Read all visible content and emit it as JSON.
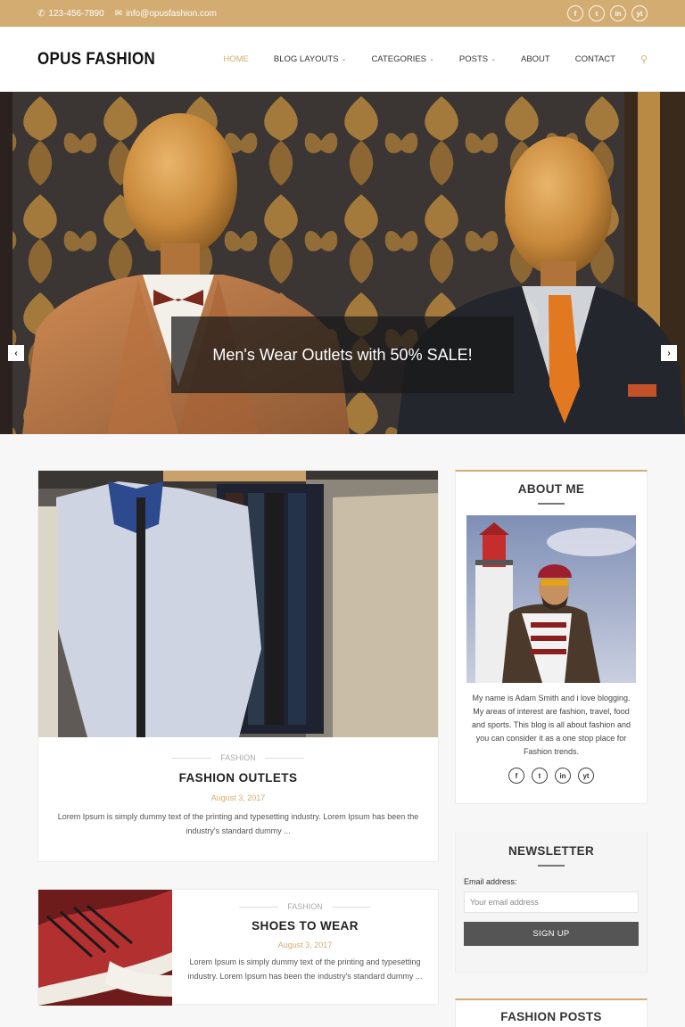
{
  "topbar": {
    "phone": "123-456-7890",
    "email": "info@opusfashion.com",
    "social": [
      "f",
      "t",
      "in",
      "yt"
    ]
  },
  "header": {
    "logo": "OPUS FASHION",
    "nav": [
      {
        "label": "HOME",
        "active": true,
        "caret": false
      },
      {
        "label": "BLOG LAYOUTS",
        "active": false,
        "caret": true
      },
      {
        "label": "CATEGORIES",
        "active": false,
        "caret": true
      },
      {
        "label": "POSTS",
        "active": false,
        "caret": true
      },
      {
        "label": "ABOUT",
        "active": false,
        "caret": false
      },
      {
        "label": "CONTACT",
        "active": false,
        "caret": false
      }
    ]
  },
  "hero": {
    "caption": "Men's Wear Outlets with 50% SALE!",
    "prev": "‹",
    "next": "›"
  },
  "posts": [
    {
      "category": "FASHION",
      "title": "FASHION OUTLETS",
      "date": "August 3, 2017",
      "excerpt": "Lorem Ipsum is simply dummy text of the printing and typesetting industry. Lorem Ipsum has been the industry's standard dummy ..."
    },
    {
      "category": "FASHION",
      "title": "SHOES TO WEAR",
      "date": "August 3, 2017",
      "excerpt": "Lorem Ipsum is simply dummy text of the printing and typesetting industry. Lorem Ipsum has been the industry's standard dummy ..."
    }
  ],
  "sidebar": {
    "about": {
      "title": "ABOUT ME",
      "bio": "My name is Adam Smith and i love blogging. My areas of interest are fashion, travel, food and sports. This blog is all about fashion and you can consider it as a one stop place for Fashion trends."
    },
    "newsletter": {
      "title": "NEWSLETTER",
      "label": "Email address:",
      "placeholder": "Your email address",
      "button": "SIGN UP"
    },
    "fashion_posts": {
      "title": "FASHION POSTS"
    }
  },
  "colors": {
    "accent": "#d3ac72",
    "dark_button": "#555555"
  }
}
